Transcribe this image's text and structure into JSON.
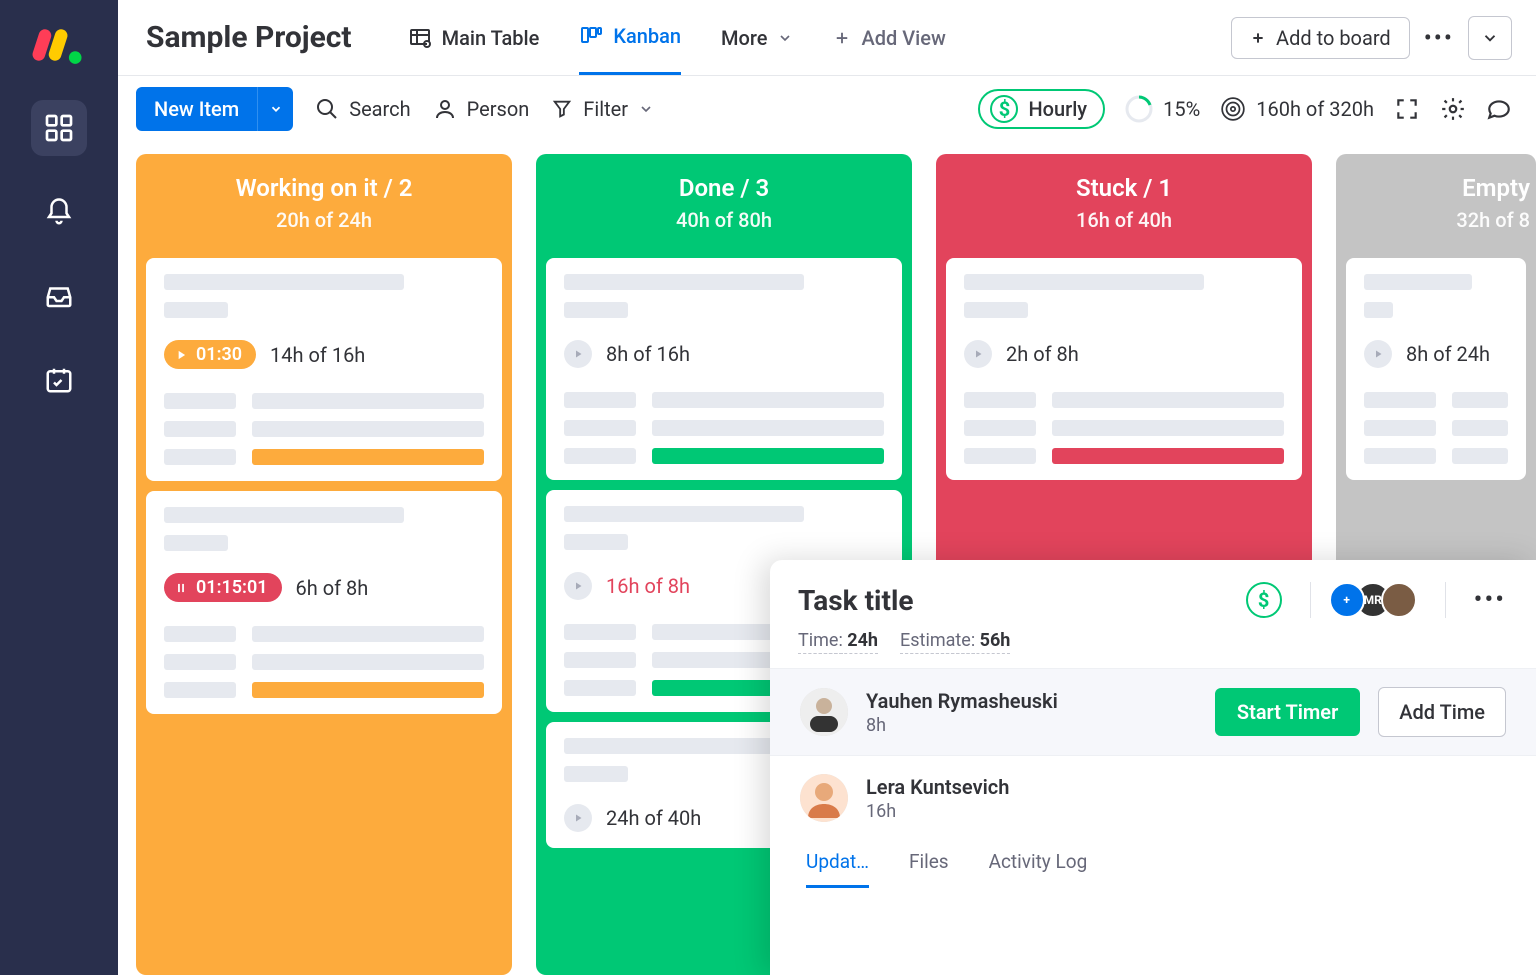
{
  "board_title": "Sample Project",
  "tabs": {
    "main_table": "Main Table",
    "kanban": "Kanban",
    "more": "More",
    "add_view": "Add View"
  },
  "header": {
    "add_to_board": "Add to board"
  },
  "toolbar": {
    "new_item": "New Item",
    "search": "Search",
    "person": "Person",
    "filter": "Filter",
    "hourly": "Hourly",
    "progress_pct": "15%",
    "hours_summary": "160h of 320h"
  },
  "columns": [
    {
      "title": "Working on it / 2",
      "sub": "20h of 24h",
      "color": "working"
    },
    {
      "title": "Done / 3",
      "sub": "40h of 80h",
      "color": "done"
    },
    {
      "title": "Stuck / 1",
      "sub": "16h of 40h",
      "color": "stuck"
    },
    {
      "title": "Empty",
      "sub": "32h of 8",
      "color": "empty"
    }
  ],
  "cards": {
    "w1": {
      "timer": "01:30",
      "stat": "14h of 16h"
    },
    "w2": {
      "timer": "01:15:01",
      "stat": "6h of 8h"
    },
    "d1": {
      "stat": "8h of 16h"
    },
    "d2": {
      "stat": "16h of 8h"
    },
    "d3": {
      "stat": "24h of 40h"
    },
    "s1": {
      "stat": "2h of 8h"
    },
    "e1": {
      "stat": "8h of 24h"
    }
  },
  "task_panel": {
    "title": "Task title",
    "time_label": "Time:",
    "time_value": "24h",
    "estimate_label": "Estimate:",
    "estimate_value": "56h",
    "avatar_text": "MR",
    "people": [
      {
        "name": "Yauhen Rymasheuski",
        "time": "8h"
      },
      {
        "name": "Lera Kuntsevich",
        "time": "16h"
      }
    ],
    "start_timer": "Start Timer",
    "add_time": "Add Time",
    "tabs": {
      "updates": "Updat…",
      "files": "Files",
      "activity": "Activity Log"
    }
  }
}
